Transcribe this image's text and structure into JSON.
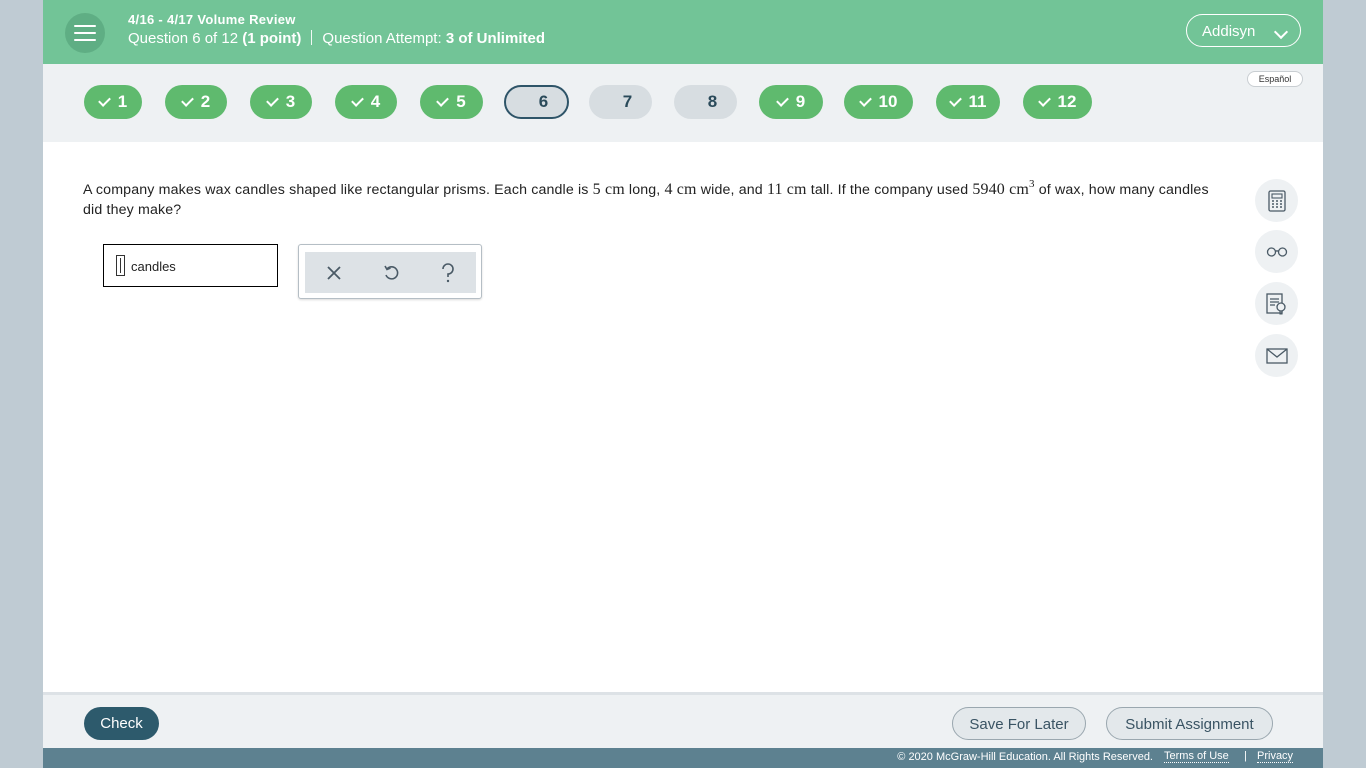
{
  "header": {
    "assignment_title": "4/16 - 4/17 Volume Review",
    "question_label": "Question 6 of 12",
    "points": "(1 point)",
    "attempt_label": "Question Attempt:",
    "attempt_value": "3 of Unlimited",
    "user_name": "Addisyn"
  },
  "nav": {
    "language": "Español",
    "questions": [
      {
        "number": "1",
        "status": "answered"
      },
      {
        "number": "2",
        "status": "answered"
      },
      {
        "number": "3",
        "status": "answered"
      },
      {
        "number": "4",
        "status": "answered"
      },
      {
        "number": "5",
        "status": "answered"
      },
      {
        "number": "6",
        "status": "current"
      },
      {
        "number": "7",
        "status": "unanswered"
      },
      {
        "number": "8",
        "status": "unanswered"
      },
      {
        "number": "9",
        "status": "answered"
      },
      {
        "number": "10",
        "status": "answered"
      },
      {
        "number": "11",
        "status": "answered"
      },
      {
        "number": "12",
        "status": "answered"
      }
    ]
  },
  "question": {
    "t1": "A company makes wax candles shaped like rectangular prisms. Each candle is ",
    "len": "5 cm",
    "t2": " long, ",
    "wid": "4 cm",
    "t3": " wide, and ",
    "tall": "11 cm",
    "t4": " tall. If the company used ",
    "vol": "5940 cm",
    "exp": "3",
    "t5": " of wax, how many candles did they make?"
  },
  "answer": {
    "value": "",
    "unit": "candles"
  },
  "answer_tools": {
    "clear_icon": "close-icon",
    "reset_icon": "undo-icon",
    "help_icon": "question-icon"
  },
  "side_tools": [
    "calculator-icon",
    "glasses-icon",
    "hint-icon",
    "mail-icon"
  ],
  "footer": {
    "check_label": "Check",
    "save_label": "Save For Later",
    "submit_label": "Submit Assignment",
    "copyright": "© 2020 McGraw-Hill Education. All Rights Reserved.",
    "terms": "Terms of Use",
    "privacy": "Privacy"
  },
  "colors": {
    "header": "#72c497",
    "answered": "#5fba6e",
    "unanswered": "#d7dde1",
    "primary_button": "#2d5a6c",
    "legal_bar": "#5d8190"
  }
}
